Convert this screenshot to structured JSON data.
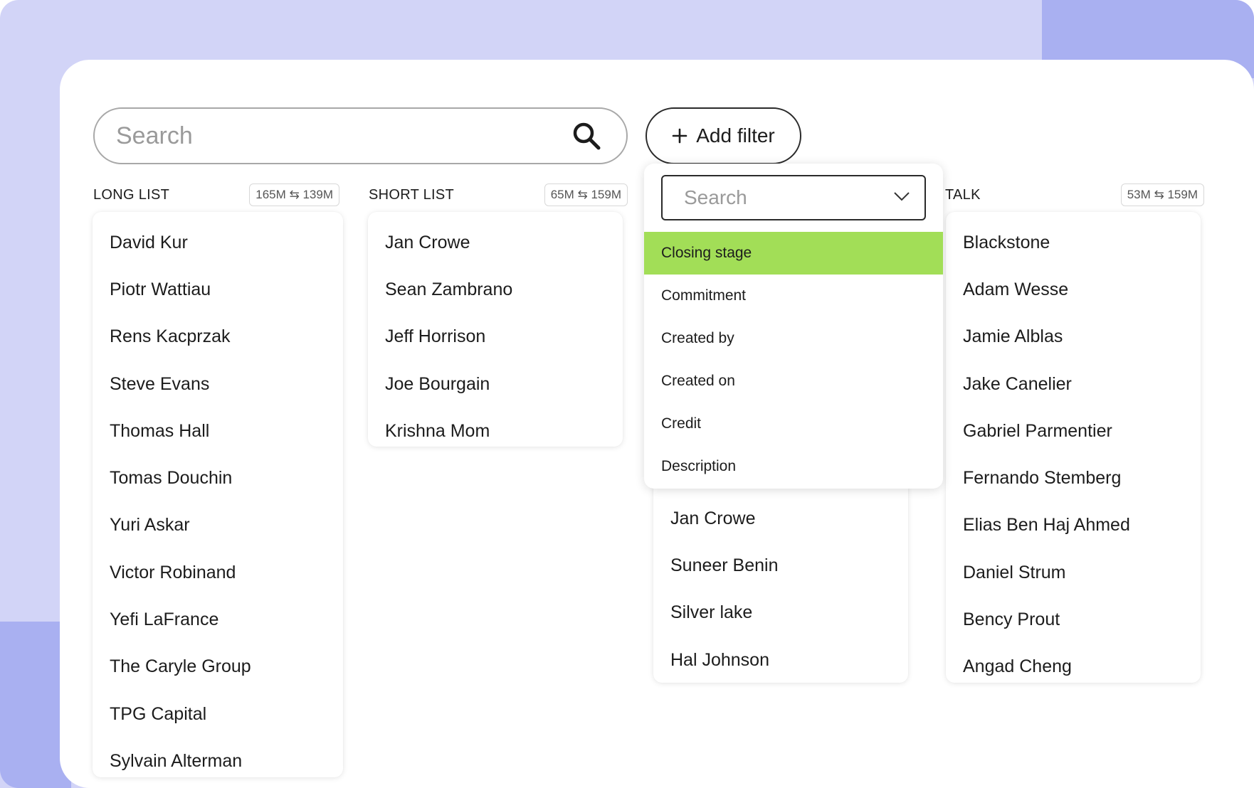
{
  "search": {
    "placeholder": "Search"
  },
  "add_filter": {
    "label": "Add filter",
    "icon": "plus-icon"
  },
  "filter_dropdown": {
    "placeholder": "Search",
    "selected_index": 0,
    "options": [
      "Closing stage",
      "Commitment",
      "Created by",
      "Created on",
      "Credit",
      "Description"
    ],
    "highlight_color": "#a2de57"
  },
  "columns": [
    {
      "title": "LONG LIST",
      "badge": "165M ⇆ 139M",
      "items": [
        "David Kur",
        "Piotr Wattiau",
        "Rens Kacprzak",
        "Steve Evans",
        "Thomas Hall",
        "Tomas Douchin",
        "Yuri Askar",
        "Victor Robinand",
        "Yefi LaFrance",
        "The Caryle Group",
        "TPG Capital",
        "Sylvain Alterman"
      ]
    },
    {
      "title": "SHORT LIST",
      "badge": "65M ⇆ 159M",
      "items": [
        "Jan Crowe",
        "Sean Zambrano",
        "Jeff Horrison",
        "Joe Bourgain",
        "Krishna Mom"
      ]
    },
    {
      "title": "",
      "badge": "",
      "items": [
        "Jan Crowe",
        "Suneer Benin",
        "Silver lake",
        "Hal Johnson"
      ]
    },
    {
      "title": "TALK",
      "badge": "53M ⇆ 159M",
      "items": [
        "Blackstone",
        "Adam Wesse",
        "Jamie Alblas",
        "Jake Canelier",
        "Gabriel Parmentier",
        "Fernando Stemberg",
        "Elias Ben Haj Ahmed",
        "Daniel Strum",
        "Bency Prout",
        "Angad Cheng"
      ]
    }
  ],
  "colors": {
    "background_lavender": "#d2d4f7",
    "background_accent": "#a9b0f1"
  }
}
